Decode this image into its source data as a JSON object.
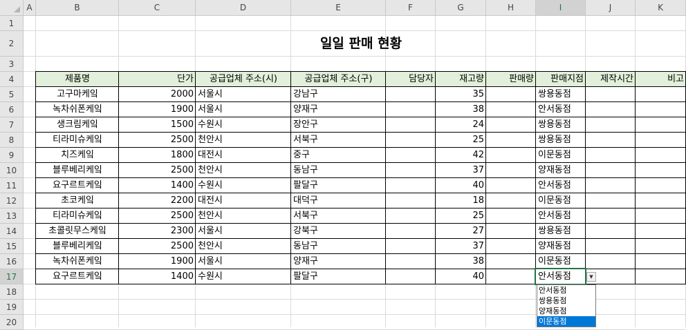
{
  "sheet": {
    "corner": "",
    "columns": [
      "A",
      "B",
      "C",
      "D",
      "E",
      "F",
      "G",
      "H",
      "I",
      "J",
      "K"
    ],
    "rows": [
      "1",
      "2",
      "3",
      "4",
      "5",
      "6",
      "7",
      "8",
      "9",
      "10",
      "11",
      "12",
      "13",
      "14",
      "15",
      "16",
      "17",
      "18",
      "19",
      "20"
    ]
  },
  "title": "일일 판매 현황",
  "colors": {
    "header_fill": "#e2efda",
    "grid_line": "#dadada",
    "selection": "#217346",
    "dropdown_highlight": "#0078d7"
  },
  "table": {
    "headers": [
      "제품명",
      "단가",
      "공급업체 주소(시)",
      "공급업체 주소(구)",
      "담당자",
      "재고량",
      "판매량",
      "판매지점",
      "제작시간",
      "비고"
    ],
    "rows": [
      [
        "고구마케잌",
        "2000",
        "서울시",
        "강남구",
        "",
        "35",
        "",
        "쌍용동점",
        "",
        ""
      ],
      [
        "녹차쉬폰케잌",
        "1900",
        "서울시",
        "양재구",
        "",
        "38",
        "",
        "안서동점",
        "",
        ""
      ],
      [
        "생크림케잌",
        "1500",
        "수원시",
        "장안구",
        "",
        "24",
        "",
        "쌍용동점",
        "",
        ""
      ],
      [
        "티라미슈케잌",
        "2500",
        "천안시",
        "서북구",
        "",
        "25",
        "",
        "쌍용동점",
        "",
        ""
      ],
      [
        "치즈케잌",
        "1800",
        "대전시",
        "중구",
        "",
        "42",
        "",
        "이문동점",
        "",
        ""
      ],
      [
        "블루베리케잌",
        "2500",
        "천안시",
        "동남구",
        "",
        "37",
        "",
        "양재동점",
        "",
        ""
      ],
      [
        "요구르트케잌",
        "1400",
        "수원시",
        "팔달구",
        "",
        "40",
        "",
        "안서동점",
        "",
        ""
      ],
      [
        "초코케잌",
        "2200",
        "대전시",
        "대덕구",
        "",
        "18",
        "",
        "이문동점",
        "",
        ""
      ],
      [
        "티라미슈케잌",
        "2500",
        "천안시",
        "서북구",
        "",
        "25",
        "",
        "안서동점",
        "",
        ""
      ],
      [
        "초콜릿무스케잌",
        "2300",
        "서울시",
        "강북구",
        "",
        "27",
        "",
        "쌍용동점",
        "",
        ""
      ],
      [
        "블루베리케잌",
        "2500",
        "천안시",
        "동남구",
        "",
        "37",
        "",
        "양재동점",
        "",
        ""
      ],
      [
        "녹차쉬폰케잌",
        "1900",
        "서울시",
        "양재구",
        "",
        "38",
        "",
        "이문동점",
        "",
        ""
      ],
      [
        "요구르트케잌",
        "1400",
        "수원시",
        "팔달구",
        "",
        "40",
        "",
        "안서동점",
        "",
        ""
      ]
    ]
  },
  "dropdown": {
    "button_icon": "dropdown-arrow-icon",
    "options": [
      "안서동점",
      "쌍용동점",
      "양재동점",
      "이문동점"
    ],
    "highlighted": "이문동점"
  }
}
